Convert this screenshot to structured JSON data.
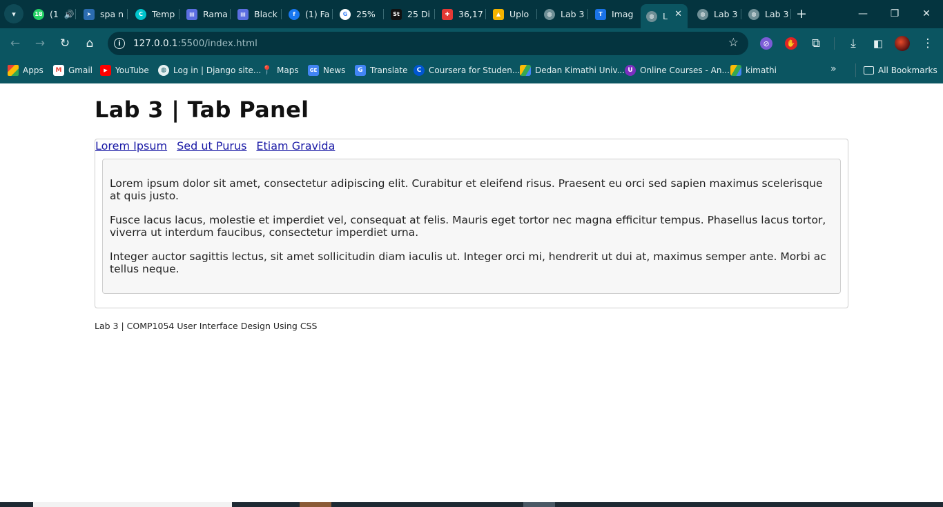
{
  "browser": {
    "tabs": [
      {
        "title": "(1",
        "favicon": "whatsapp-icon",
        "color": "#25d366"
      },
      {
        "title": "spa n",
        "favicon": "arrow-icon",
        "color": "#2b6cb0"
      },
      {
        "title": "Temp",
        "favicon": "canva-icon",
        "color": "#00c4cc"
      },
      {
        "title": "Rama",
        "favicon": "printer-icon",
        "color": "#5b6ee1"
      },
      {
        "title": "Black",
        "favicon": "printer-icon",
        "color": "#5b6ee1"
      },
      {
        "title": "(1) Fa",
        "favicon": "facebook-icon",
        "color": "#1877f2"
      },
      {
        "title": "25%",
        "favicon": "google-icon",
        "color": "#ffffff"
      },
      {
        "title": "25 Di",
        "favicon": "st-icon",
        "color": "#111111"
      },
      {
        "title": "36,17",
        "favicon": "app-icon",
        "color": "#e53935"
      },
      {
        "title": "Uplo",
        "favicon": "upload-icon",
        "color": "#f5b400"
      },
      {
        "title": "Lab 3",
        "favicon": "globe-icon",
        "color": "#6f8f96"
      },
      {
        "title": "Imag",
        "favicon": "translate-icon",
        "color": "#1a73e8"
      },
      {
        "title": "L",
        "favicon": "globe-icon",
        "color": "#6f8f96",
        "active": true
      },
      {
        "title": "Lab 3",
        "favicon": "globe-icon",
        "color": "#6f8f96"
      },
      {
        "title": "Lab 3",
        "favicon": "globe-icon",
        "color": "#6f8f96"
      }
    ],
    "address": {
      "host": "127.0.0.1",
      "path": ":5500/index.html"
    },
    "bookmarks": [
      {
        "label": "Apps",
        "icon": "apps-grid-icon"
      },
      {
        "label": "Gmail",
        "icon": "gmail-icon"
      },
      {
        "label": "YouTube",
        "icon": "youtube-icon"
      },
      {
        "label": "Log in | Django site...",
        "icon": "globe-icon"
      },
      {
        "label": "Maps",
        "icon": "maps-icon"
      },
      {
        "label": "News",
        "icon": "news-icon"
      },
      {
        "label": "Translate",
        "icon": "translate-icon"
      },
      {
        "label": "Coursera for Studen...",
        "icon": "coursera-icon"
      },
      {
        "label": "Dedan Kimathi Univ...",
        "icon": "drive-icon"
      },
      {
        "label": "Online Courses - An...",
        "icon": "courses-icon"
      },
      {
        "label": "kimathi",
        "icon": "drive-icon"
      }
    ],
    "all_bookmarks": "All Bookmarks"
  },
  "page": {
    "title": "Lab 3 | Tab Panel",
    "tabs": [
      "Lorem Ipsum",
      "Sed ut Purus",
      "Etiam Gravida"
    ],
    "paragraphs": [
      "Lorem ipsum dolor sit amet, consectetur adipiscing elit. Curabitur et eleifend risus. Praesent eu orci sed sapien maximus scelerisque at quis justo.",
      "Fusce lacus lacus, molestie et imperdiet vel, consequat at felis. Mauris eget tortor nec magna efficitur tempus. Phasellus lacus tortor, viverra ut interdum faucibus, consectetur imperdiet urna.",
      "Integer auctor sagittis lectus, sit amet sollicitudin diam iaculis ut. Integer orci mi, hendrerit ut dui at, maximus semper ante. Morbi ac tellus neque."
    ],
    "footer": "Lab 3 | COMP1054 User Interface Design Using CSS"
  }
}
